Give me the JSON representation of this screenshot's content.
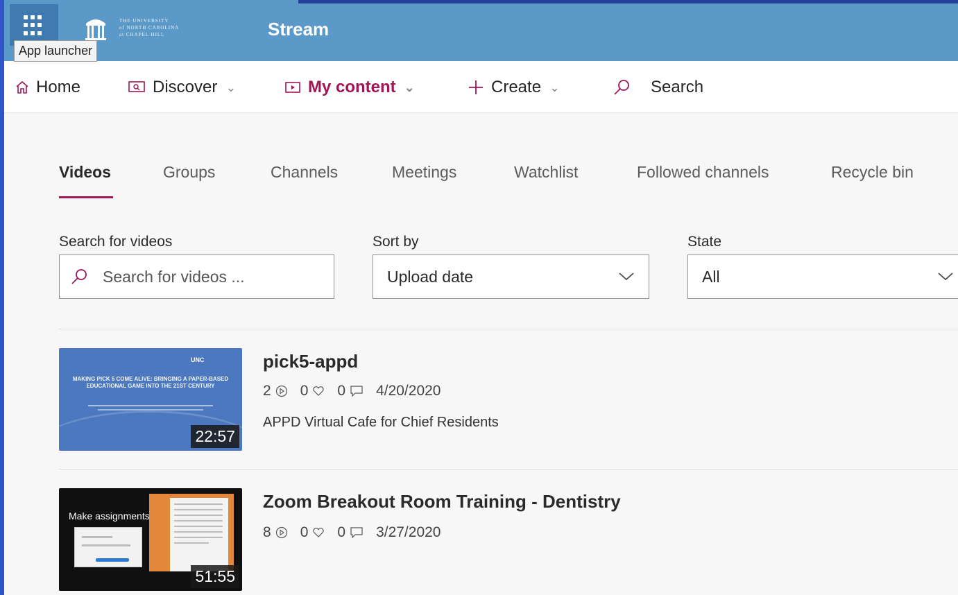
{
  "appbar": {
    "launcher_tooltip": "App launcher",
    "logo_lines": [
      "THE UNIVERSITY",
      "of NORTH CAROLINA",
      "at CHAPEL HILL"
    ],
    "brand": "Stream",
    "color": "#5b9ac8"
  },
  "nav": {
    "home": "Home",
    "discover": "Discover",
    "my_content": "My content",
    "create": "Create",
    "search": "Search",
    "accent_color": "#a01657"
  },
  "tabs": [
    "Videos",
    "Groups",
    "Channels",
    "Meetings",
    "Watchlist",
    "Followed channels",
    "Recycle bin"
  ],
  "active_tab": "Videos",
  "filters": {
    "search_label": "Search for videos",
    "search_placeholder": "Search for videos ...",
    "sort_label": "Sort by",
    "sort_value": "Upload date",
    "state_label": "State",
    "state_value": "All"
  },
  "videos": [
    {
      "title": "pick5-appd",
      "views": "2",
      "likes": "0",
      "comments": "0",
      "date": "4/20/2020",
      "description": "APPD Virtual Cafe for Chief Residents",
      "duration": "22:57",
      "thumb_heading": "MAKING PICK 5 COME ALIVE: BRINGING A PAPER-BASED EDUCATIONAL GAME INTO THE 21ST CENTURY",
      "thumb_logo": "UNC"
    },
    {
      "title": "Zoom Breakout Room Training - Dentistry",
      "views": "8",
      "likes": "0",
      "comments": "0",
      "date": "3/27/2020",
      "duration": "51:55",
      "thumb_heading": "Make assignments"
    }
  ]
}
